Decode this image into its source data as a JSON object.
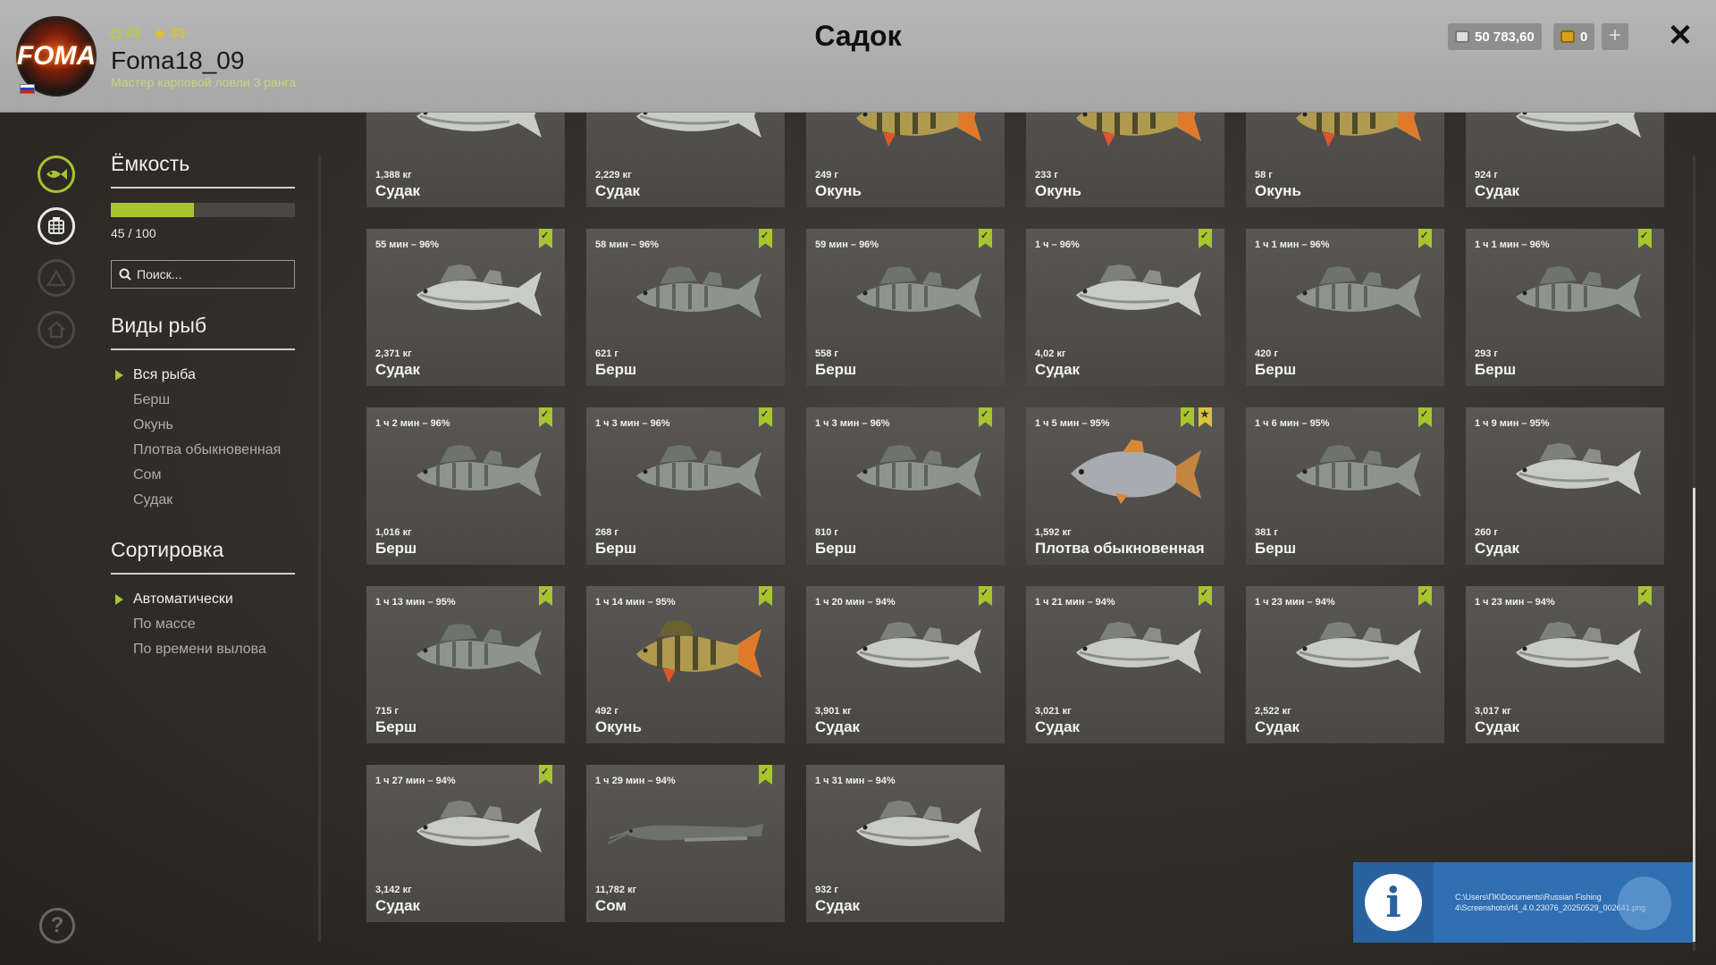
{
  "header": {
    "title": "Садок",
    "avatar_text": "FOMA",
    "level": "33",
    "stars": "33",
    "username": "Foma18_09",
    "rank": "Мастер карповой ловли 3 ранга",
    "silver": "50 783,60",
    "gold": "0",
    "plus_label": "+",
    "close_label": "✕"
  },
  "nav": {
    "help_label": "?"
  },
  "sidebar": {
    "capacity_title": "Ёмкость",
    "capacity_value": 45,
    "capacity_max": 100,
    "capacity_text": "45 / 100",
    "search_placeholder": "Поиск...",
    "species_title": "Виды рыб",
    "species": [
      {
        "label": "Вся рыба",
        "active": true
      },
      {
        "label": "Берш",
        "active": false
      },
      {
        "label": "Окунь",
        "active": false
      },
      {
        "label": "Плотва обыкновенная",
        "active": false
      },
      {
        "label": "Сом",
        "active": false
      },
      {
        "label": "Судак",
        "active": false
      }
    ],
    "sort_title": "Сортировка",
    "sort": [
      {
        "label": "Автоматически",
        "active": true
      },
      {
        "label": "По массе",
        "active": false
      },
      {
        "label": "По времени вылова",
        "active": false
      }
    ]
  },
  "fish": [
    {
      "time": "",
      "weight": "1,388 кг",
      "name": "Судак",
      "kind": "zander",
      "bookmark": false,
      "star": false
    },
    {
      "time": "",
      "weight": "2,229 кг",
      "name": "Судак",
      "kind": "zander",
      "bookmark": false,
      "star": false
    },
    {
      "time": "",
      "weight": "249 г",
      "name": "Окунь",
      "kind": "perch",
      "bookmark": false,
      "star": false
    },
    {
      "time": "",
      "weight": "233 г",
      "name": "Окунь",
      "kind": "perch",
      "bookmark": false,
      "star": false
    },
    {
      "time": "",
      "weight": "58 г",
      "name": "Окунь",
      "kind": "perch",
      "bookmark": false,
      "star": false
    },
    {
      "time": "",
      "weight": "924 г",
      "name": "Судак",
      "kind": "zander",
      "bookmark": false,
      "star": false
    },
    {
      "time": "55 мин – 96%",
      "weight": "2,371 кг",
      "name": "Судак",
      "kind": "zander",
      "bookmark": true,
      "star": false
    },
    {
      "time": "58 мин – 96%",
      "weight": "621 г",
      "name": "Берш",
      "kind": "bersh",
      "bookmark": true,
      "star": false
    },
    {
      "time": "59 мин – 96%",
      "weight": "558 г",
      "name": "Берш",
      "kind": "bersh",
      "bookmark": true,
      "star": false
    },
    {
      "time": "1 ч – 96%",
      "weight": "4,02 кг",
      "name": "Судак",
      "kind": "zander",
      "bookmark": true,
      "star": false
    },
    {
      "time": "1 ч 1 мин – 96%",
      "weight": "420 г",
      "name": "Берш",
      "kind": "bersh",
      "bookmark": true,
      "star": false
    },
    {
      "time": "1 ч 1 мин – 96%",
      "weight": "293 г",
      "name": "Берш",
      "kind": "bersh",
      "bookmark": true,
      "star": false
    },
    {
      "time": "1 ч 2 мин – 96%",
      "weight": "1,016 кг",
      "name": "Берш",
      "kind": "bersh",
      "bookmark": true,
      "star": false
    },
    {
      "time": "1 ч 3 мин – 96%",
      "weight": "268 г",
      "name": "Берш",
      "kind": "bersh",
      "bookmark": true,
      "star": false
    },
    {
      "time": "1 ч 3 мин – 96%",
      "weight": "810 г",
      "name": "Берш",
      "kind": "bersh",
      "bookmark": true,
      "star": false
    },
    {
      "time": "1 ч 5 мин – 95%",
      "weight": "1,592 кг",
      "name": "Плотва обыкновенная",
      "kind": "roach",
      "bookmark": true,
      "star": true
    },
    {
      "time": "1 ч 6 мин – 95%",
      "weight": "381 г",
      "name": "Берш",
      "kind": "bersh",
      "bookmark": true,
      "star": false
    },
    {
      "time": "1 ч 9 мин – 95%",
      "weight": "260 г",
      "name": "Судак",
      "kind": "zander",
      "bookmark": false,
      "star": false
    },
    {
      "time": "1 ч 13 мин – 95%",
      "weight": "715 г",
      "name": "Берш",
      "kind": "bersh",
      "bookmark": true,
      "star": false
    },
    {
      "time": "1 ч 14 мин – 95%",
      "weight": "492 г",
      "name": "Окунь",
      "kind": "perch",
      "bookmark": true,
      "star": false
    },
    {
      "time": "1 ч 20 мин – 94%",
      "weight": "3,901 кг",
      "name": "Судак",
      "kind": "zander",
      "bookmark": true,
      "star": false
    },
    {
      "time": "1 ч 21 мин – 94%",
      "weight": "3,021 кг",
      "name": "Судак",
      "kind": "zander",
      "bookmark": true,
      "star": false
    },
    {
      "time": "1 ч 23 мин – 94%",
      "weight": "2,522 кг",
      "name": "Судак",
      "kind": "zander",
      "bookmark": true,
      "star": false
    },
    {
      "time": "1 ч 23 мин – 94%",
      "weight": "3,017 кг",
      "name": "Судак",
      "kind": "zander",
      "bookmark": true,
      "star": false
    },
    {
      "time": "1 ч 27 мин – 94%",
      "weight": "3,142 кг",
      "name": "Судак",
      "kind": "zander",
      "bookmark": true,
      "star": false
    },
    {
      "time": "1 ч 29 мин – 94%",
      "weight": "11,782 кг",
      "name": "Сом",
      "kind": "catfish",
      "bookmark": true,
      "star": false
    },
    {
      "time": "1 ч 31 мин – 94%",
      "weight": "932 г",
      "name": "Судак",
      "kind": "zander",
      "bookmark": false,
      "star": false
    }
  ],
  "notification": {
    "path": "C:\\Users\\ПК\\Documents\\Russian Fishing 4\\Screenshots\\rf4_4.0.23076_20250529_002641.png"
  }
}
